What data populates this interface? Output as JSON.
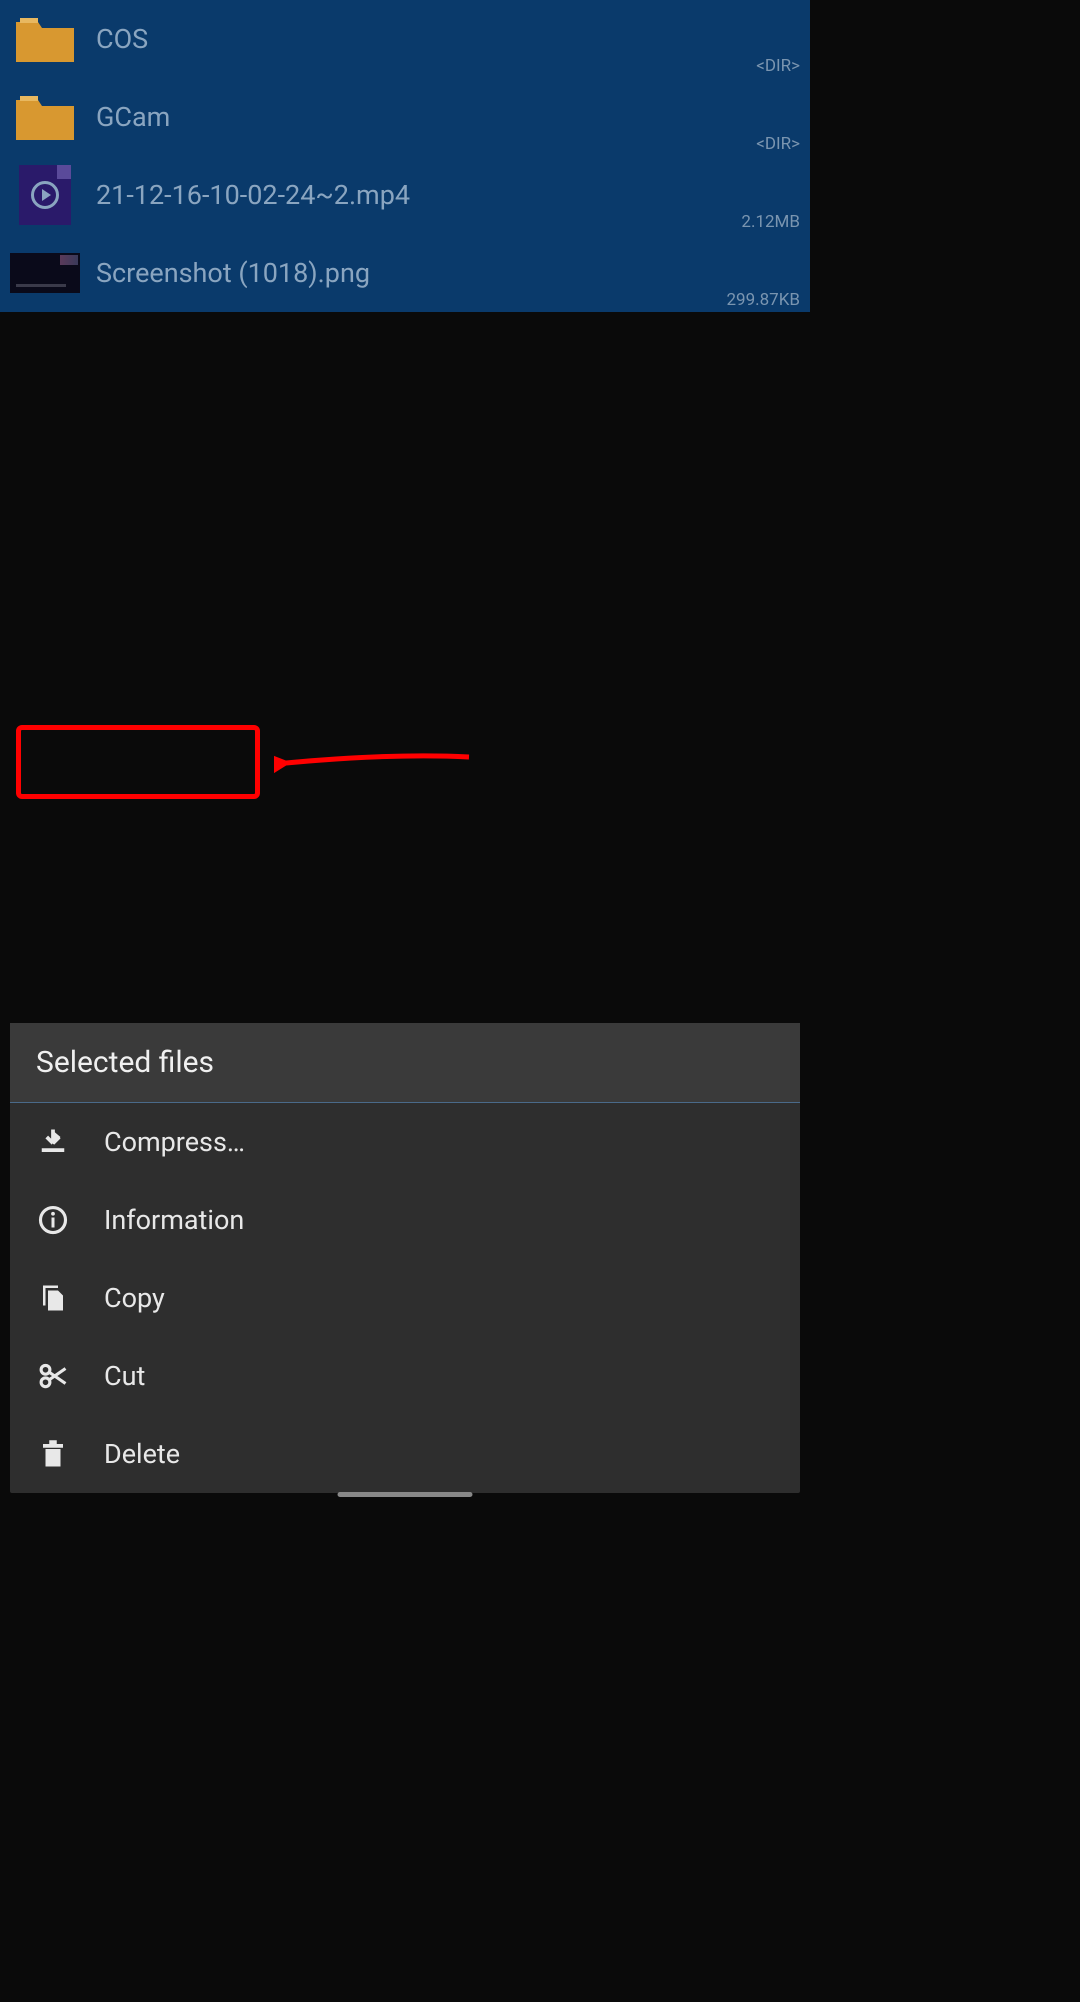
{
  "files": [
    {
      "name": "COS",
      "type": "folder",
      "size": "<DIR>"
    },
    {
      "name": "GCam",
      "type": "folder",
      "size": "<DIR>"
    },
    {
      "name": "21-12-16-10-02-24~2.mp4",
      "type": "video",
      "size": "2.12MB"
    },
    {
      "name": "Screenshot (1018).png",
      "type": "image",
      "size": "299.87KB"
    }
  ],
  "menu": {
    "header": "Selected files",
    "items": [
      {
        "label": "Compress…",
        "icon": "download"
      },
      {
        "label": "Information",
        "icon": "info"
      },
      {
        "label": "Copy",
        "icon": "copy"
      },
      {
        "label": "Cut",
        "icon": "cut"
      },
      {
        "label": "Delete",
        "icon": "trash"
      }
    ]
  }
}
